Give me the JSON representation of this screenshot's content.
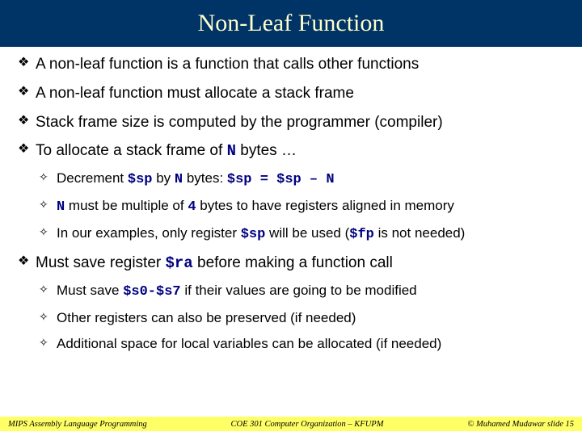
{
  "title": "Non-Leaf Function",
  "bullets": [
    {
      "text": "A non-leaf function is a function that calls other functions"
    },
    {
      "text": "A non-leaf function must allocate a stack frame"
    },
    {
      "text": "Stack frame size is computed by the programmer (compiler)"
    },
    {
      "prefix": "To allocate a stack frame of ",
      "code1": "N",
      "suffix": " bytes …",
      "sub": [
        {
          "p1": "Decrement ",
          "c1": "$sp",
          "p2": " by ",
          "c2": "N",
          "p3": " bytes: ",
          "c3": "$sp = $sp – N",
          "p4": ""
        },
        {
          "p1": "",
          "c1": "N",
          "p2": " must be multiple of ",
          "c2": "4",
          "p3": " bytes to have registers aligned in memory",
          "c3": "",
          "p4": ""
        },
        {
          "p1": "In our examples, only register ",
          "c1": "$sp",
          "p2": " will be used (",
          "c2": "$fp",
          "p3": " is not needed)",
          "c3": "",
          "p4": ""
        }
      ]
    },
    {
      "prefix": "Must save register ",
      "code1": "$ra",
      "suffix": " before making a function call",
      "sub": [
        {
          "p1": "Must save ",
          "c1": "$s0-$s7",
          "p2": " if their values are going to be modified",
          "c2": "",
          "p3": "",
          "c3": "",
          "p4": ""
        },
        {
          "p1": "Other registers can also be preserved (if needed)",
          "c1": "",
          "p2": "",
          "c2": "",
          "p3": "",
          "c3": "",
          "p4": ""
        },
        {
          "p1": "Additional space for local variables can be allocated (if needed)",
          "c1": "",
          "p2": "",
          "c2": "",
          "p3": "",
          "c3": "",
          "p4": ""
        }
      ]
    }
  ],
  "footer": {
    "left": "MIPS Assembly Language Programming",
    "center": "COE 301 Computer Organization – KFUPM",
    "right": "© Muhamed Mudawar   slide 15"
  }
}
